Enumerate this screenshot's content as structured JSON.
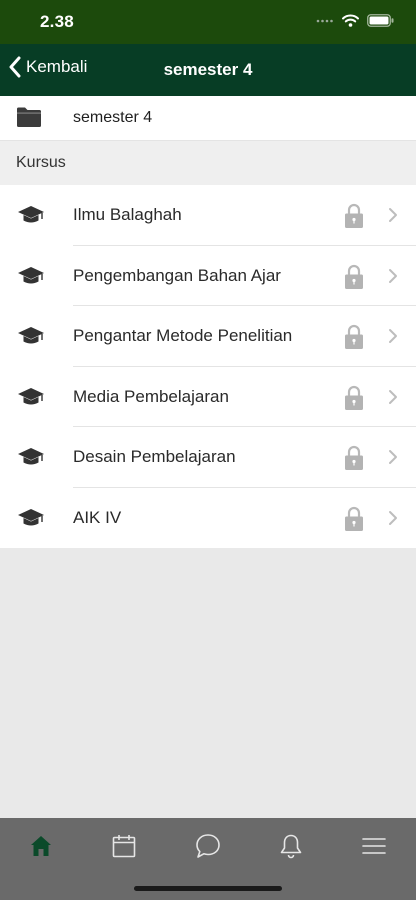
{
  "status_bar": {
    "time": "2.38"
  },
  "nav": {
    "back_label": "Kembali",
    "title": "semester 4"
  },
  "folder": {
    "name": "semester 4"
  },
  "section": {
    "title": "Kursus"
  },
  "courses": [
    {
      "name": "Ilmu Balaghah",
      "locked": true
    },
    {
      "name": "Pengembangan Bahan Ajar",
      "locked": true
    },
    {
      "name": "Pengantar Metode Penelitian",
      "locked": true
    },
    {
      "name": "Media Pembelajaran",
      "locked": true
    },
    {
      "name": "Desain Pembelajaran",
      "locked": true
    },
    {
      "name": "AIK IV",
      "locked": true
    }
  ],
  "tab_bar": {
    "tabs": [
      {
        "icon": "home-icon",
        "active": true
      },
      {
        "icon": "calendar-icon",
        "active": false
      },
      {
        "icon": "chat-icon",
        "active": false
      },
      {
        "icon": "bell-icon",
        "active": false
      },
      {
        "icon": "menu-icon",
        "active": false
      }
    ],
    "active_color": "#0b4a2a",
    "inactive_color": "#e6e6e6"
  },
  "colors": {
    "status_bar": "#1c4a0c",
    "nav_bar": "#073d25",
    "background": "#e9e9e9"
  }
}
